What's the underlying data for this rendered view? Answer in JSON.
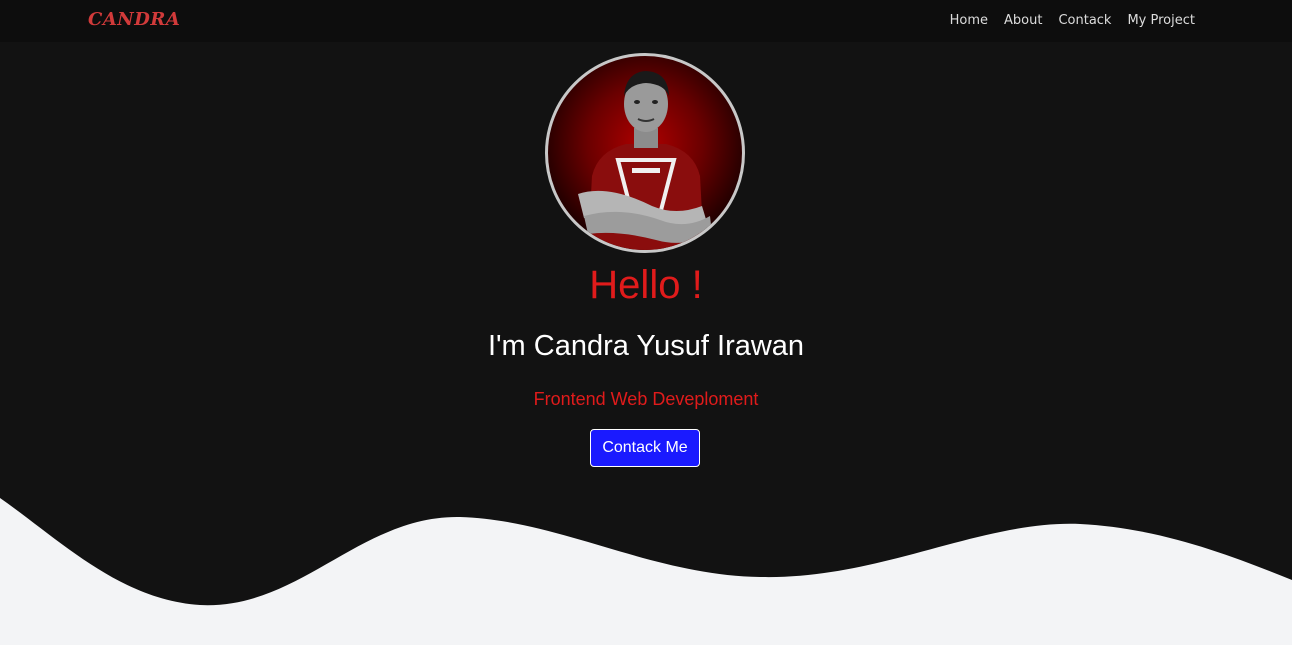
{
  "nav": {
    "brand": "CANDRA",
    "links": [
      "Home",
      "About",
      "Contack",
      "My Project"
    ]
  },
  "hero": {
    "greeting": "Hello !",
    "name": "I'm Candra Yusuf Irawan",
    "role": "Frontend Web Deveploment",
    "cta_label": "Contack Me"
  },
  "colors": {
    "background": "#121212",
    "accent_red": "#e01b1b",
    "button_blue": "#1a1aff",
    "wave": "#f3f4f6"
  }
}
